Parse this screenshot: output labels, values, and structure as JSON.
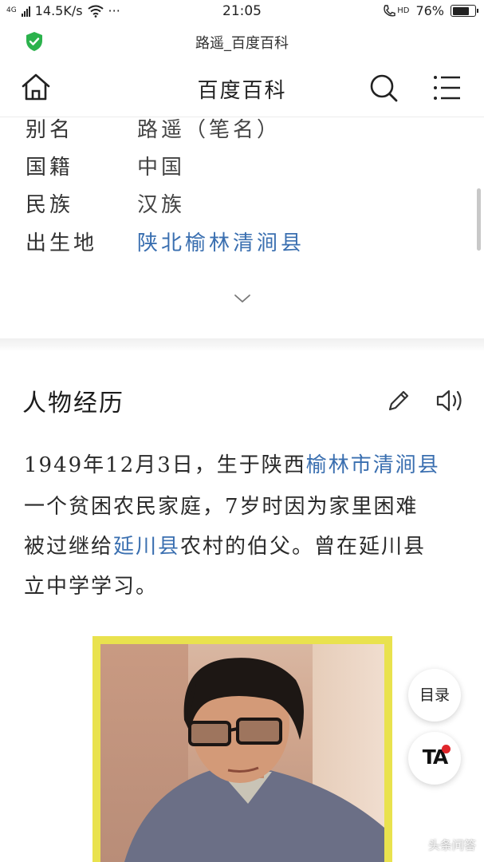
{
  "status_bar": {
    "network": "4G",
    "speed": "14.5K/s",
    "more": "···",
    "time": "21:05",
    "hd": "HD",
    "battery": "76%",
    "battery_level": 0.76
  },
  "url_bar": {
    "title": "路遥_百度百科"
  },
  "header": {
    "title": "百度百科"
  },
  "info": [
    {
      "key": "别名",
      "value": "路遥（笔名）"
    },
    {
      "key": "国籍",
      "value": "中国"
    },
    {
      "key": "民族",
      "value": "汉族"
    },
    {
      "key": "出生地",
      "value": "陕北榆林清涧县"
    }
  ],
  "section": {
    "title": "人物经历",
    "lines": [
      {
        "a": "1949年12月3日，生于陕西",
        "link": "榆林市清涧县",
        "b": ""
      },
      {
        "a": "一个贫困农民家庭，7岁时因为家里困难",
        "link": "",
        "b": ""
      },
      {
        "a": "被过继给",
        "link": "延川县",
        "b": "农村的伯父。曾在延川县"
      },
      {
        "a": "立中学学习。",
        "link": "",
        "b": ""
      }
    ]
  },
  "floating": {
    "toc": "目录",
    "ta": "TA"
  },
  "watermark": "头条问答",
  "colors": {
    "link": "#3a6fb0",
    "shield": "#2bb24c",
    "photo_border": "#e9e24e",
    "ta_dot": "#e0262b"
  }
}
